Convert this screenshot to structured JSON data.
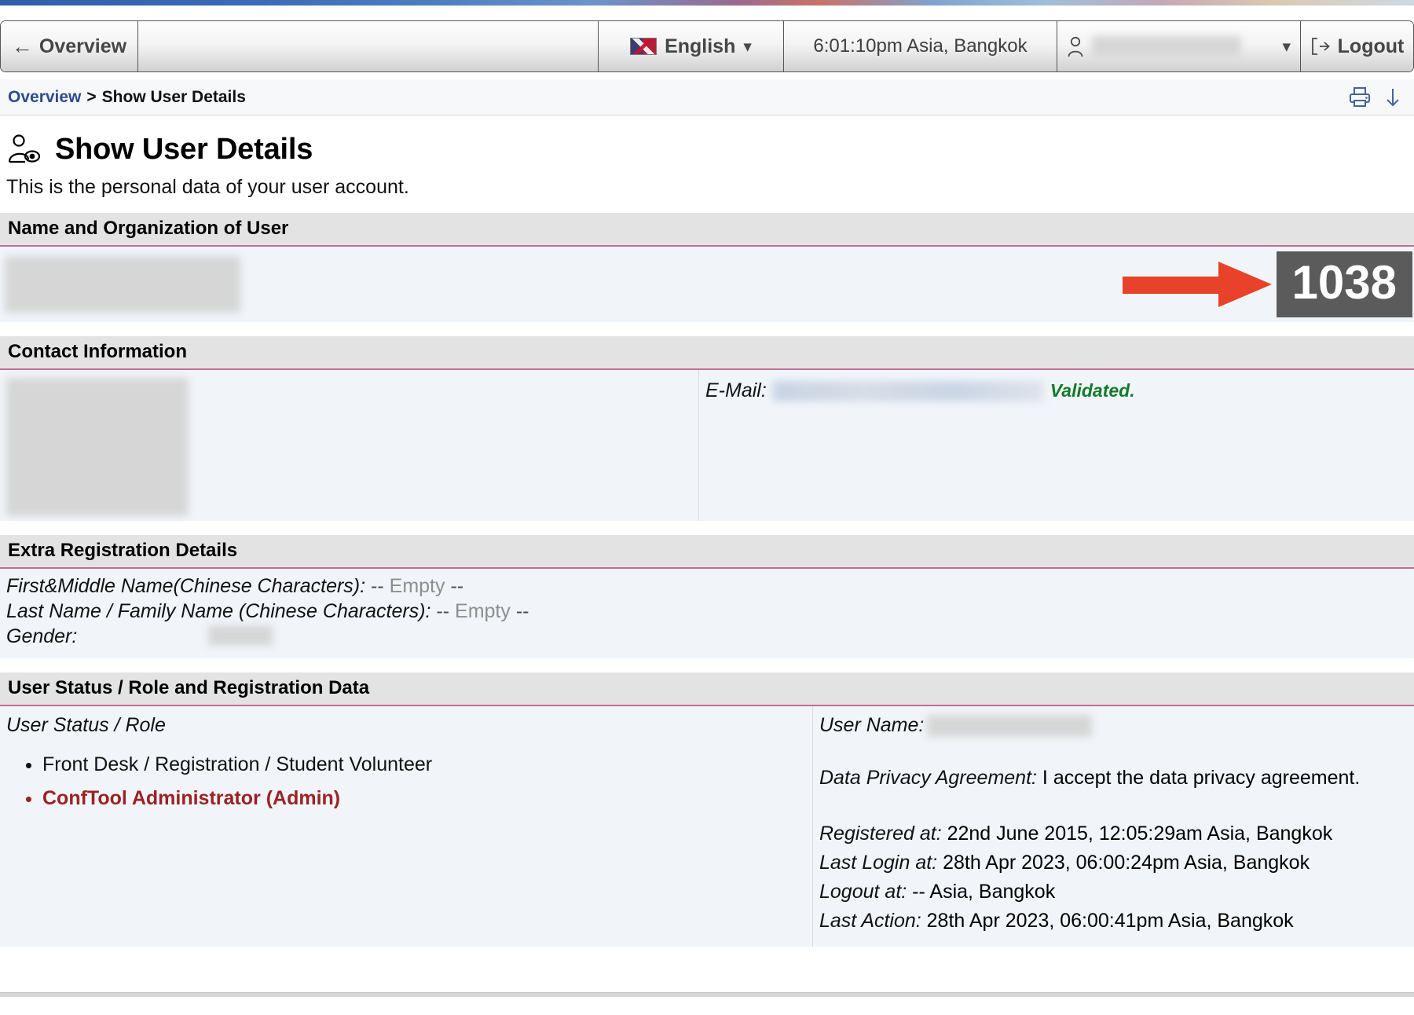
{
  "toolbar": {
    "overview_label": "Overview",
    "back_icon": "arrow-left-icon",
    "language_label": "English",
    "language_caret": "⌄",
    "time_label": "6:01:10pm  Asia, Bangkok",
    "user_caret": "⌄",
    "logout_label": "Logout"
  },
  "breadcrumb": {
    "root": "Overview",
    "separator": ">",
    "current": "Show User Details"
  },
  "page": {
    "title": "Show User Details",
    "intro": "This is the personal data of your user account."
  },
  "sections": {
    "name_org": {
      "heading": "Name and Organization of User",
      "badge_number": "1038"
    },
    "contact": {
      "heading": "Contact Information",
      "email_label": "E-Mail:",
      "email_status": "Validated."
    },
    "extra": {
      "heading": "Extra Registration Details",
      "rows": [
        {
          "label": "First&Middle Name(Chinese Characters):",
          "value_prefix": "--",
          "value_word": "Empty",
          "value_suffix": "--"
        },
        {
          "label": "Last Name / Family Name (Chinese Characters):",
          "value_prefix": "--",
          "value_word": "Empty",
          "value_suffix": "--"
        },
        {
          "label": "Gender:",
          "value_prefix": "",
          "value_word": "",
          "value_suffix": ""
        }
      ]
    },
    "status": {
      "heading": "User Status / Role and Registration Data",
      "role_label": "User Status / Role",
      "roles": [
        {
          "label": "Front Desk / Registration / Student Volunteer",
          "admin": false
        },
        {
          "label": "ConfTool Administrator (Admin)",
          "admin": true
        }
      ],
      "username_label": "User Name:",
      "privacy_label": "Data Privacy Agreement:",
      "privacy_value": "I accept the data privacy agreement.",
      "meta": [
        {
          "label": "Registered at:",
          "value": "22nd June 2015, 12:05:29am Asia, Bangkok"
        },
        {
          "label": "Last Login at:",
          "value": "28th Apr 2023, 06:00:24pm Asia, Bangkok"
        },
        {
          "label": "Logout at:",
          "value": "-- Asia, Bangkok"
        },
        {
          "label": "Last Action:",
          "value": "28th Apr 2023, 06:00:41pm Asia, Bangkok"
        }
      ]
    }
  },
  "colors": {
    "accent_rule": "#bf6e93",
    "section_head_bg": "#e4e3e3",
    "section_body_bg": "#f1f5fa",
    "badge_bg": "#5b5b5b",
    "arrow_red": "#e8432a",
    "admin_red": "#9c2222",
    "validated_green": "#147a2b",
    "link_blue": "#2e4b8f"
  },
  "icons": {
    "page_title": "user-view-icon",
    "print": "printer-icon",
    "download": "download-arrow-icon",
    "user": "person-icon",
    "logout": "logout-icon",
    "flag": "uk-us-flag-icon"
  }
}
